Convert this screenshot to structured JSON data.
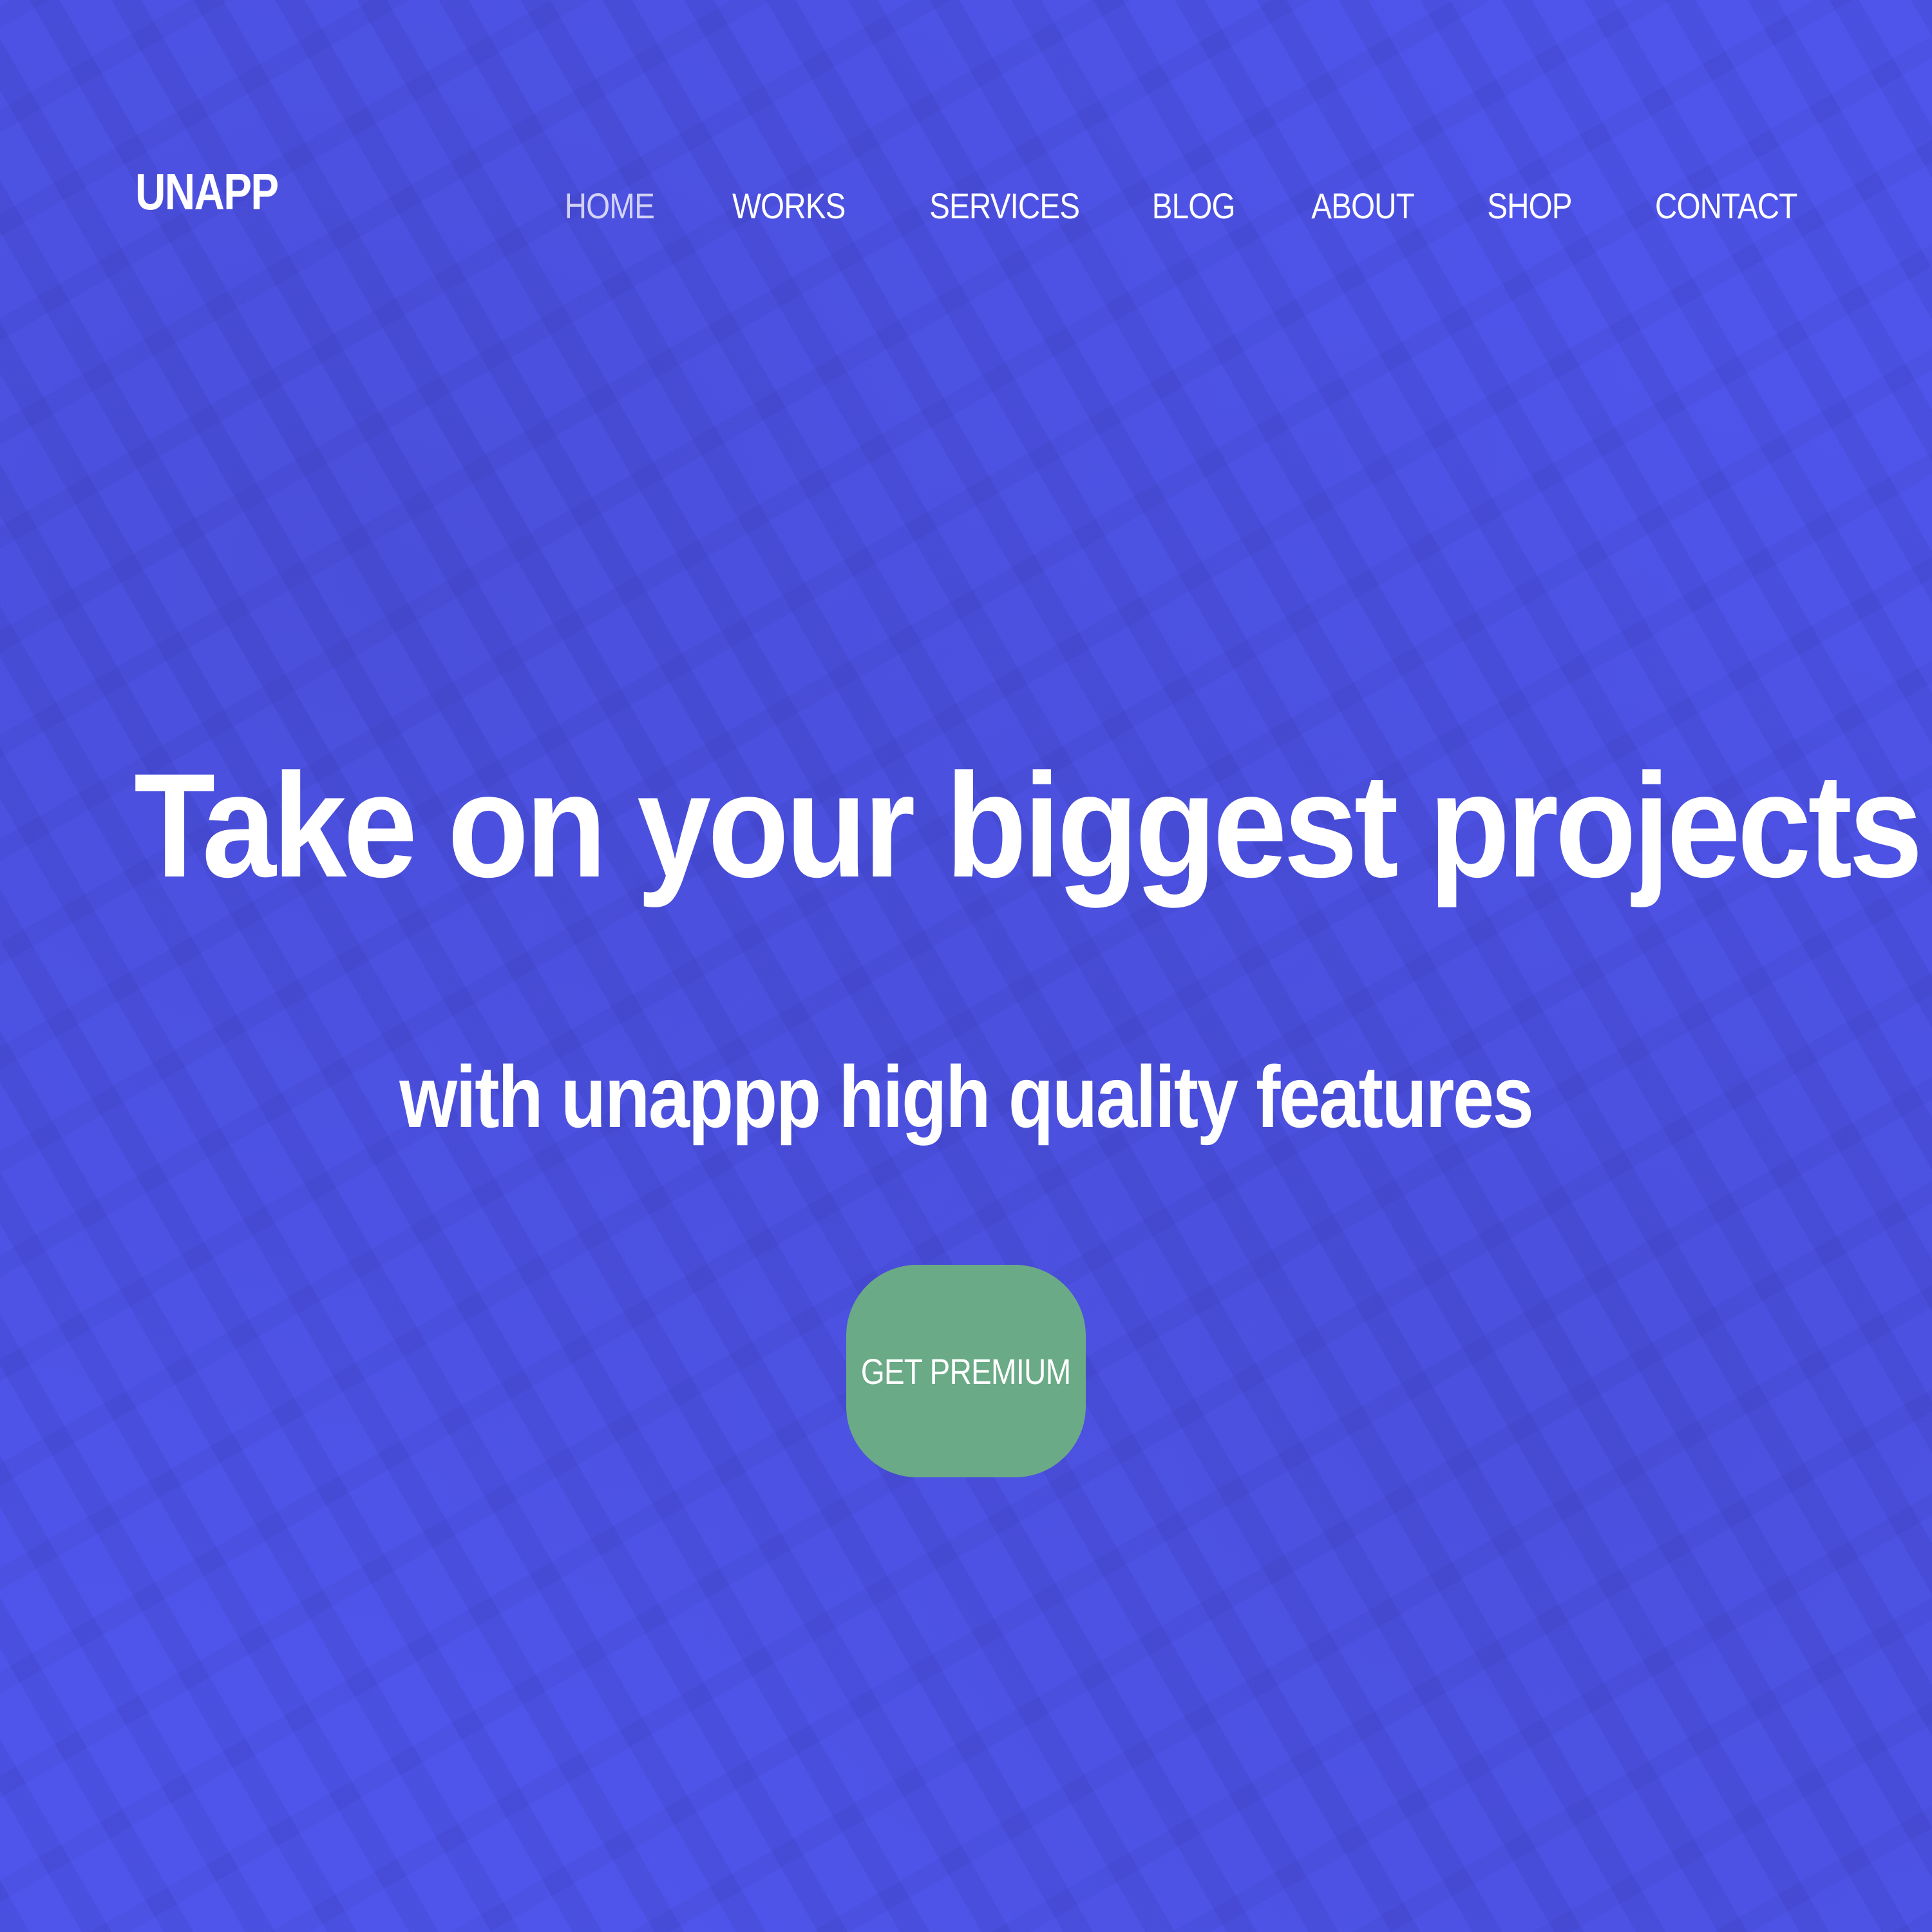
{
  "header": {
    "brand": "UNAPP",
    "nav": [
      {
        "label": "HOME",
        "active": true
      },
      {
        "label": "WORKS",
        "active": false
      },
      {
        "label": "SERVICES",
        "active": false
      },
      {
        "label": "BLOG",
        "active": false
      },
      {
        "label": "ABOUT",
        "active": false
      },
      {
        "label": "SHOP",
        "active": false
      },
      {
        "label": "CONTACT",
        "active": false
      }
    ]
  },
  "hero": {
    "title": "Take on your biggest projects and goals",
    "subtitle": "with unappp high quality features",
    "cta_label": "GET PREMIUM"
  },
  "colors": {
    "background": "#4f55eb",
    "accent_button": "#6aaa86",
    "text": "#ffffff"
  }
}
